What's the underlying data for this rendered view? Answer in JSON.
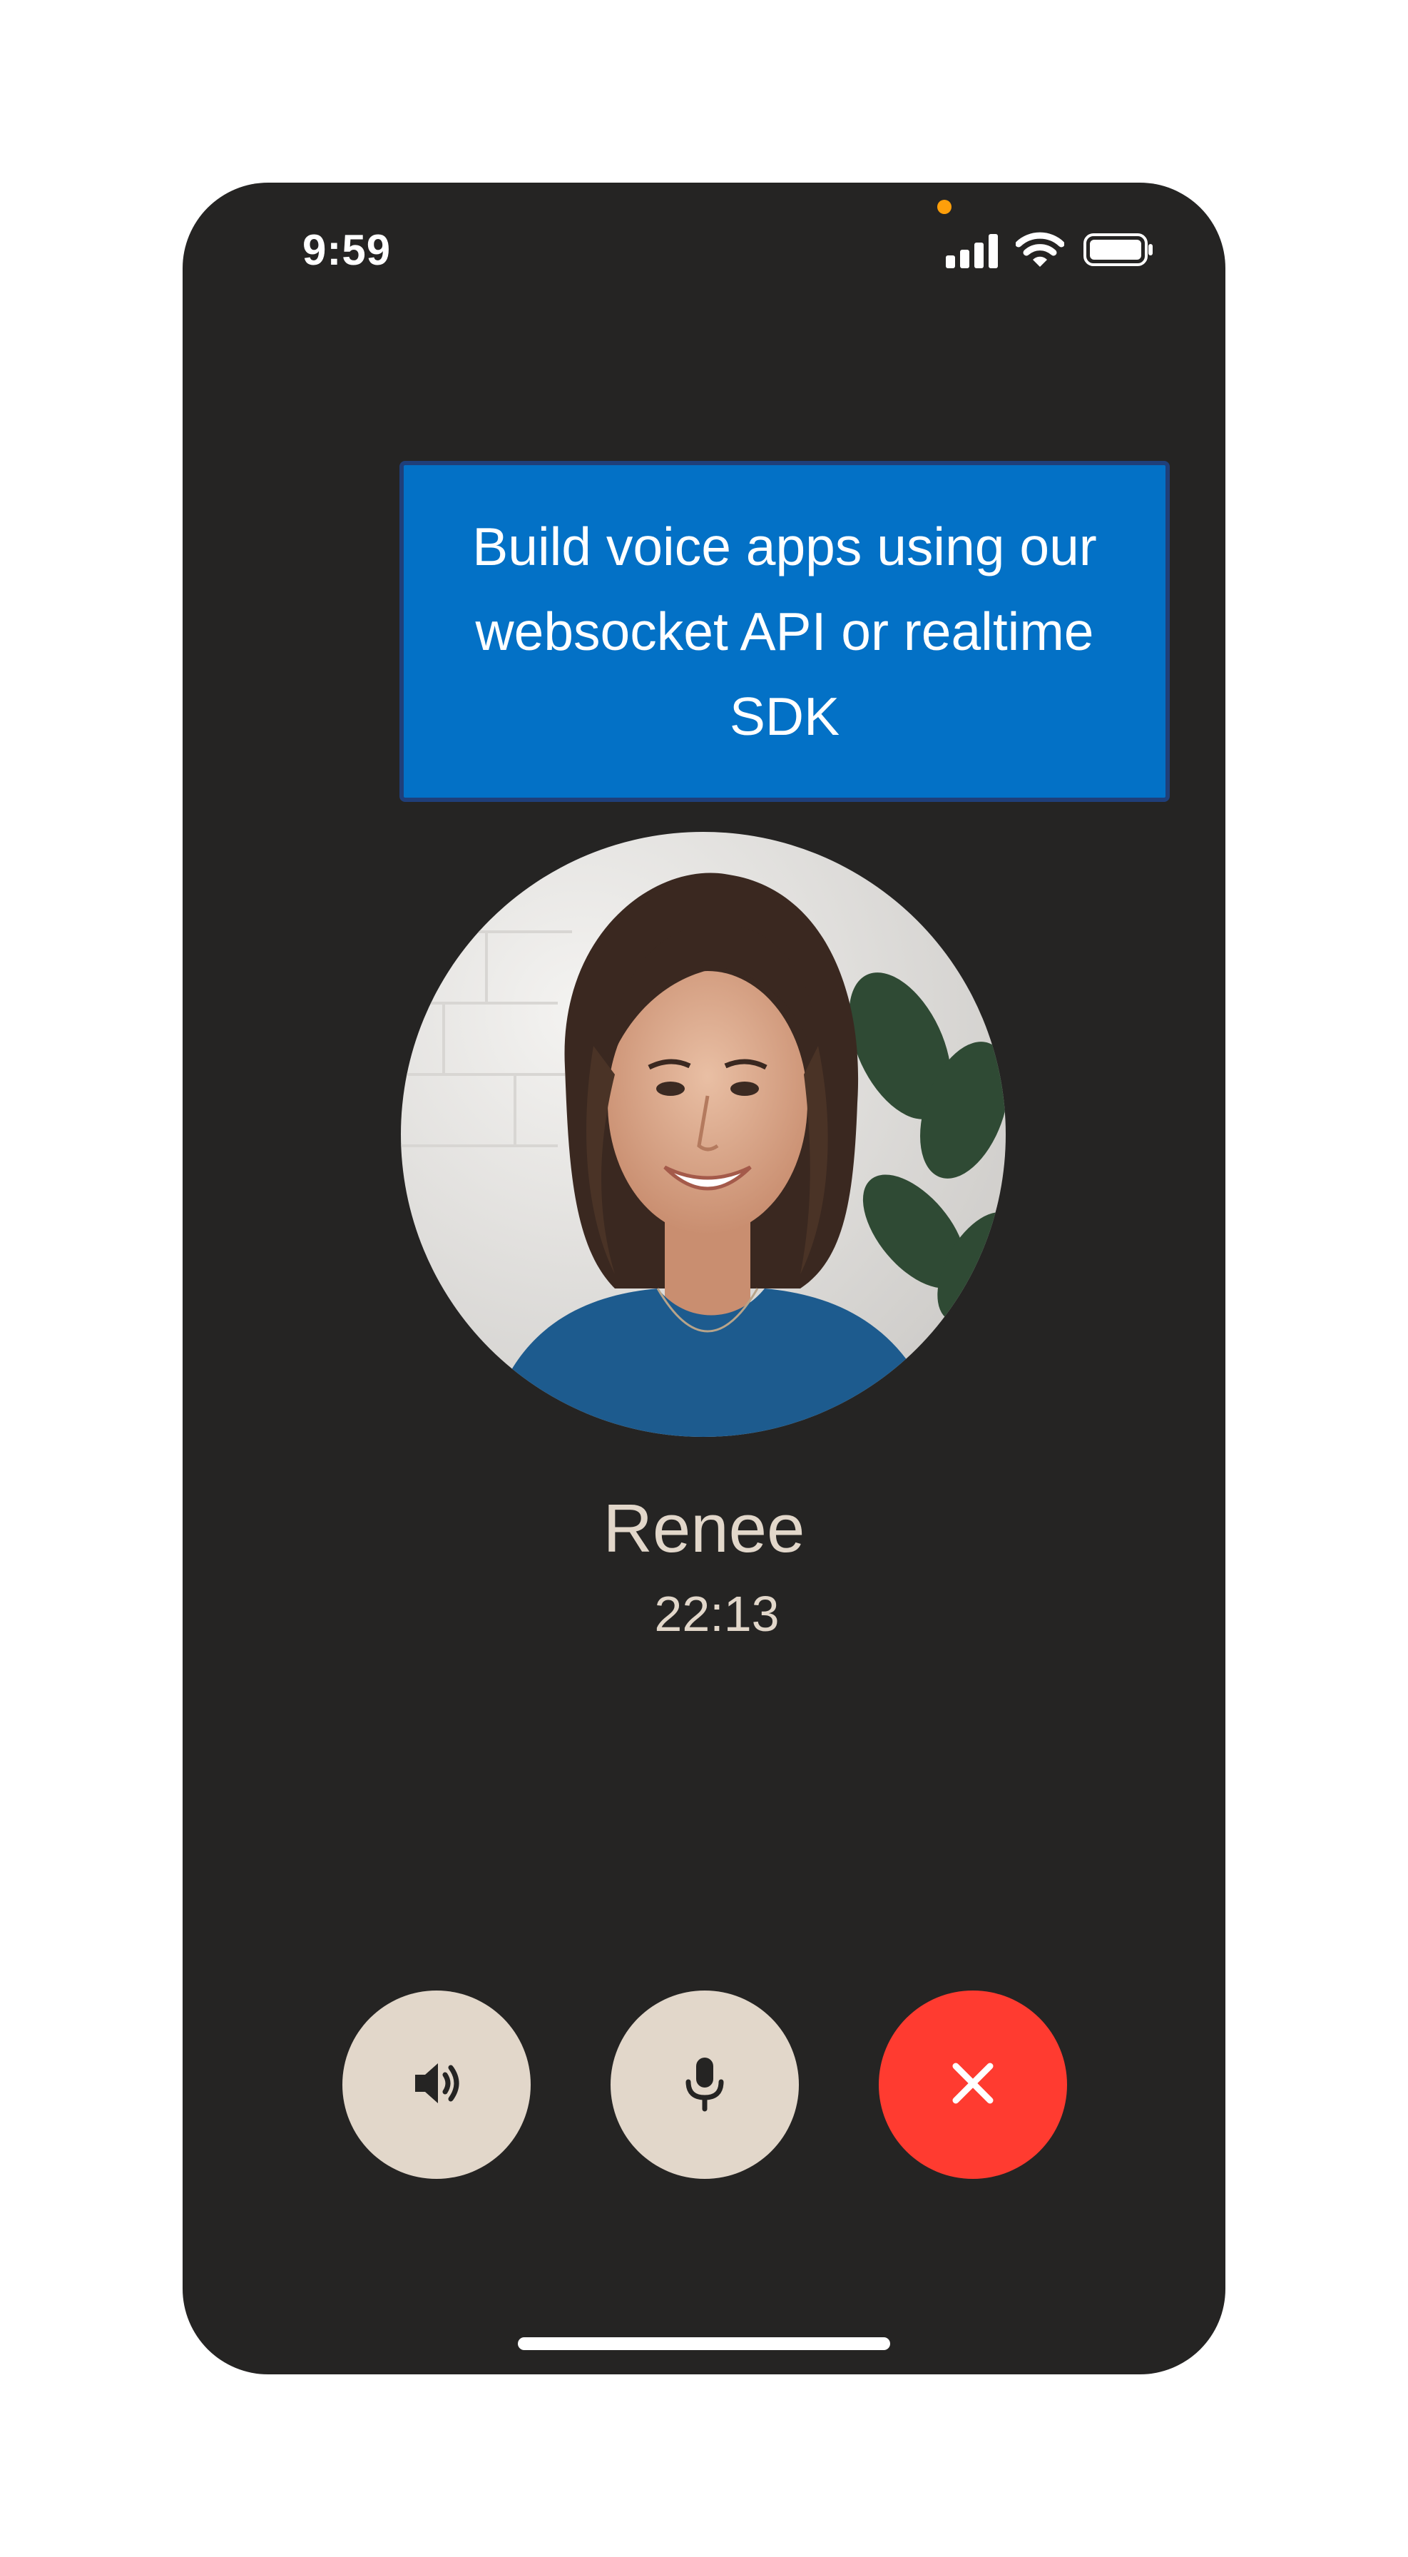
{
  "status_bar": {
    "time": "9:59",
    "icons": [
      "signal-icon",
      "wifi-icon",
      "battery-icon"
    ],
    "privacy_indicator_color": "#ff9f0a"
  },
  "banner": {
    "text": "Build voice apps using our websocket API or realtime SDK",
    "background_color": "#0371c6"
  },
  "call": {
    "caller_name": "Renee",
    "duration": "22:13"
  },
  "controls": [
    {
      "name": "speaker",
      "icon": "speaker-icon",
      "color": "#e2d7ca"
    },
    {
      "name": "mute",
      "icon": "microphone-icon",
      "color": "#e2d7ca"
    },
    {
      "name": "end-call",
      "icon": "close-icon",
      "color": "#ff3b30"
    }
  ],
  "colors": {
    "screen_background": "#252423",
    "accent_text": "#e2d7ca"
  }
}
